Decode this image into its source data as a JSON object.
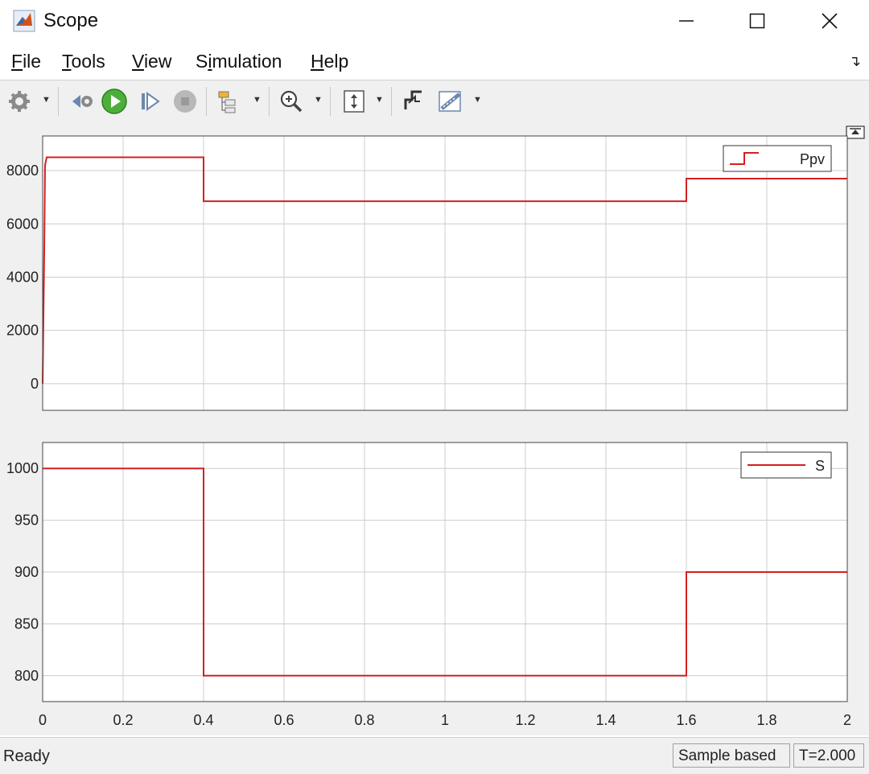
{
  "window": {
    "title": "Scope"
  },
  "menu": {
    "items": [
      {
        "label": "File",
        "mnemonic": "F",
        "rest": "ile"
      },
      {
        "label": "Tools",
        "mnemonic": "T",
        "rest": "ools"
      },
      {
        "label": "View",
        "mnemonic": "V",
        "rest": "iew"
      },
      {
        "label": "Simulation",
        "pre": "S",
        "mnemonic": "i",
        "rest": "mulation"
      },
      {
        "label": "Help",
        "mnemonic": "H",
        "rest": "elp"
      }
    ]
  },
  "toolbar": {
    "icons": [
      "gear-icon",
      "step-back-icon",
      "run-icon",
      "step-forward-icon",
      "stop-icon",
      "signal-hierarchy-icon",
      "zoom-in-icon",
      "autoscale-icon",
      "triggers-icon",
      "measurements-icon"
    ]
  },
  "colors": {
    "trace": "#d42020",
    "grid": "#cccccc",
    "axes_bg": "#ffffff",
    "figure_bg": "#f0f0f0"
  },
  "chart_data": [
    {
      "type": "line",
      "legend": [
        "Ppv"
      ],
      "legend_position": "top-right",
      "xlim": [
        0,
        2
      ],
      "ylim": [
        -1000,
        9300
      ],
      "yticks": [
        "0",
        "2000",
        "4000",
        "6000",
        "8000"
      ],
      "ytick_values": [
        0,
        2000,
        4000,
        6000,
        8000
      ],
      "grid": true,
      "series": [
        {
          "name": "Ppv",
          "x": [
            0,
            0.002,
            0.004,
            0.006,
            0.01,
            0.4,
            0.4,
            1.6,
            1.6,
            2.0
          ],
          "y": [
            0,
            2500,
            5000,
            8200,
            8500,
            8500,
            6850,
            6850,
            7700,
            7700
          ]
        }
      ]
    },
    {
      "type": "line",
      "legend": [
        "S"
      ],
      "legend_position": "top-right",
      "xlim": [
        0,
        2
      ],
      "ylim": [
        775,
        1025
      ],
      "xticks": [
        "0",
        "0.2",
        "0.4",
        "0.6",
        "0.8",
        "1",
        "1.2",
        "1.4",
        "1.6",
        "1.8",
        "2"
      ],
      "xtick_values": [
        0,
        0.2,
        0.4,
        0.6,
        0.8,
        1,
        1.2,
        1.4,
        1.6,
        1.8,
        2
      ],
      "yticks": [
        "800",
        "850",
        "900",
        "950",
        "1000"
      ],
      "ytick_values": [
        800,
        850,
        900,
        950,
        1000
      ],
      "grid": true,
      "series": [
        {
          "name": "S",
          "x": [
            0,
            0.4,
            0.4,
            1.6,
            1.6,
            2.0
          ],
          "y": [
            1000,
            1000,
            800,
            800,
            900,
            900
          ]
        }
      ]
    }
  ],
  "status": {
    "text": "Ready",
    "mode": "Sample based",
    "time": "T=2.000"
  }
}
